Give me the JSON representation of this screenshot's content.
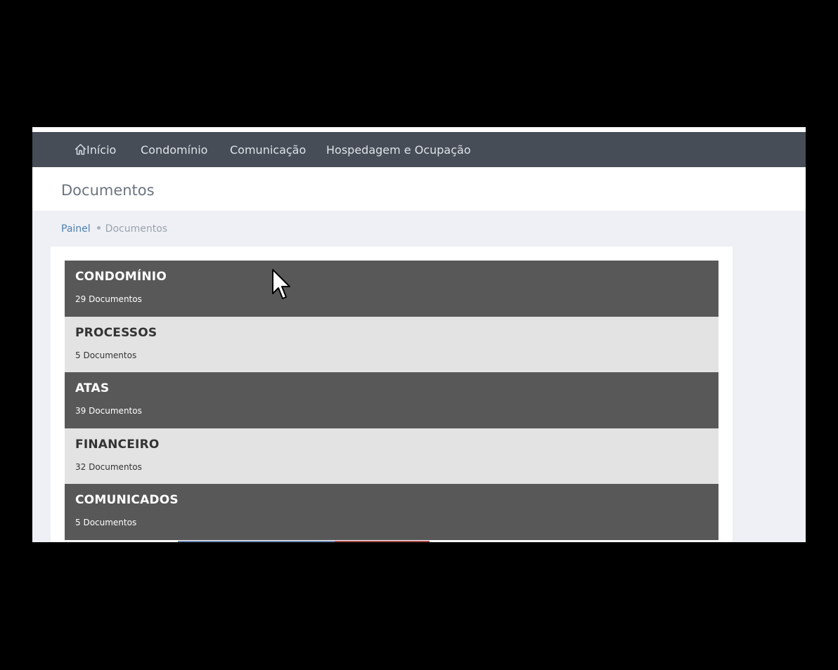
{
  "nav": {
    "items": [
      {
        "label": "Início",
        "icon": "home-icon"
      },
      {
        "label": "Condomínio"
      },
      {
        "label": "Comunicação"
      },
      {
        "label": "Hospedagem e Ocupação"
      }
    ]
  },
  "header": {
    "title": "Documentos"
  },
  "breadcrumb": {
    "link": "Painel",
    "current": "Documentos"
  },
  "folders": [
    {
      "name": "CONDOMÍNIO",
      "count": "29 Documentos"
    },
    {
      "name": "PROCESSOS",
      "count": "5 Documentos"
    },
    {
      "name": "ATAS",
      "count": "39 Documentos"
    },
    {
      "name": "FINANCEIRO",
      "count": "32 Documentos"
    },
    {
      "name": "COMUNICADOS",
      "count": "5 Documentos"
    }
  ],
  "colors": {
    "navbar": "#464d57",
    "folder_dark": "#585858",
    "folder_light": "#e3e3e3",
    "link": "#4e7fb1",
    "page_bg": "#eef0f5"
  }
}
